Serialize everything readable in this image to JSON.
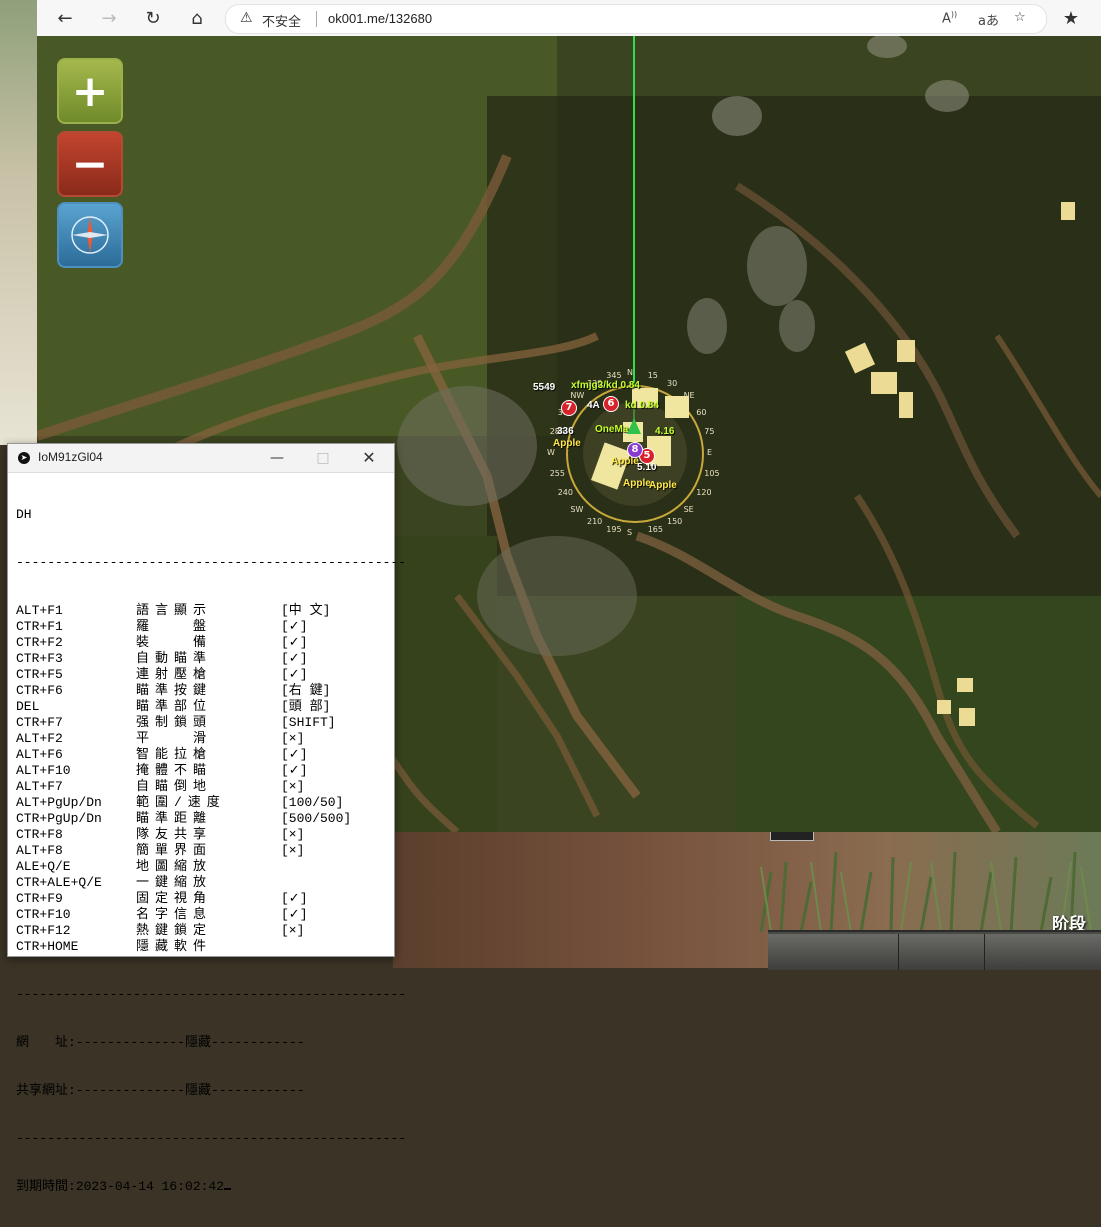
{
  "browser": {
    "back_icon": "back-arrow-icon",
    "url_security_label": "不安全",
    "url": "ok001.me/132680"
  },
  "map_labels": {
    "compass_ticks": [
      "N",
      "NE",
      "E",
      "SE",
      "S",
      "SW",
      "W",
      "NW",
      "15",
      "30",
      "60",
      "75",
      "105",
      "120",
      "150",
      "165",
      "195",
      "210",
      "240",
      "255",
      "285",
      "300",
      "330",
      "345"
    ],
    "player_tags": [
      {
        "label": "5549",
        "color": "#ffffff"
      },
      {
        "label": "xfmjg3/kd 0.84",
        "color": "#c6ff2c"
      },
      {
        "label": "4A",
        "color": "#ffffff"
      },
      {
        "label": "kd 0.84",
        "color": "#c6ff2c"
      },
      {
        "label": "OneMa",
        "color": "#c6ff2c"
      },
      {
        "label": "4.16",
        "color": "#c6ff2c"
      },
      {
        "label": "Apple",
        "color": "#ffe94a"
      },
      {
        "label": "Apple",
        "color": "#ffe94a"
      },
      {
        "label": "Apple",
        "color": "#ffe94a"
      },
      {
        "label": "Apple",
        "color": "#ffe94a"
      },
      {
        "label": "336",
        "color": "#ffffff"
      },
      {
        "label": "5.10",
        "color": "#ffffff"
      }
    ],
    "markers": [
      "7",
      "6",
      "5",
      "8"
    ],
    "stage_label": "阶段"
  },
  "console": {
    "title": "IoM91zGl04",
    "header": "DH",
    "divider": "--------------------------------------------------",
    "rows": [
      {
        "key": "ALT+F1",
        "feature": "語言顯示",
        "value": "[中 文]"
      },
      {
        "key": "CTR+F1",
        "feature": "羅　　盤",
        "value": "[✓]"
      },
      {
        "key": "CTR+F2",
        "feature": "裝　　備",
        "value": "[✓]"
      },
      {
        "key": "CTR+F3",
        "feature": "自動瞄準",
        "value": "[✓]"
      },
      {
        "key": "CTR+F5",
        "feature": "連射壓槍",
        "value": "[✓]"
      },
      {
        "key": "CTR+F6",
        "feature": "瞄準按鍵",
        "value": "[右 鍵]"
      },
      {
        "key": "DEL",
        "feature": "瞄準部位",
        "value": "[頭 部]"
      },
      {
        "key": "CTR+F7",
        "feature": "强制鎖頭",
        "value": "[SHIFT]"
      },
      {
        "key": "ALT+F2",
        "feature": "平　　滑",
        "value": "[×]"
      },
      {
        "key": "ALT+F6",
        "feature": "智能拉槍",
        "value": "[✓]"
      },
      {
        "key": "ALT+F10",
        "feature": "掩體不瞄",
        "value": "[✓]"
      },
      {
        "key": "ALT+F7",
        "feature": "自瞄倒地",
        "value": "[×]"
      },
      {
        "key": "ALT+PgUp/Dn",
        "feature": "範圍/速度",
        "value": "[100/50]"
      },
      {
        "key": "CTR+PgUp/Dn",
        "feature": "瞄準距離",
        "value": "[500/500]"
      },
      {
        "key": "CTR+F8",
        "feature": "隊友共享",
        "value": "[×]"
      },
      {
        "key": "ALT+F8",
        "feature": "簡單界面",
        "value": "[×]"
      },
      {
        "key": "ALE+Q/E",
        "feature": "地圖縮放",
        "value": ""
      },
      {
        "key": "CTR+ALE+Q/E",
        "feature": "一鍵縮放",
        "value": ""
      },
      {
        "key": "CTR+F9",
        "feature": "固定視角",
        "value": "[✓]"
      },
      {
        "key": "CTR+F10",
        "feature": "名字信息",
        "value": "[✓]"
      },
      {
        "key": "CTR+F12",
        "feature": "熱鍵鎖定",
        "value": "[×]"
      },
      {
        "key": "CTR+HOME",
        "feature": "隱藏軟件",
        "value": ""
      }
    ],
    "url_line": "網　　址:--------------隱藏------------",
    "share_line": "共享網址:--------------隱藏------------",
    "expiry_label": "到期時間:",
    "expiry_value": "2023-04-14 16:02:42"
  }
}
